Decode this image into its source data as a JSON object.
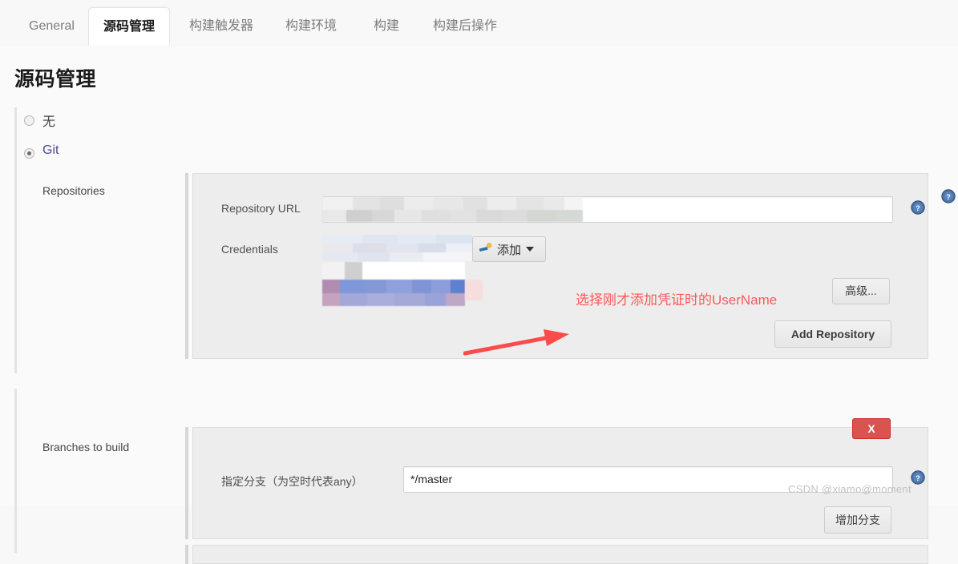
{
  "tabs": [
    {
      "label": "General",
      "active": false
    },
    {
      "label": "源码管理",
      "active": true
    },
    {
      "label": "构建触发器",
      "active": false
    },
    {
      "label": "构建环境",
      "active": false
    },
    {
      "label": "构建",
      "active": false
    },
    {
      "label": "构建后操作",
      "active": false
    }
  ],
  "page": {
    "title": "源码管理"
  },
  "scm_options": [
    {
      "label": "无",
      "selected": false
    },
    {
      "label": "Git",
      "selected": true
    }
  ],
  "repositories": {
    "section_label": "Repositories",
    "repository_url": {
      "label": "Repository URL",
      "value": "",
      "redacted": true
    },
    "credentials": {
      "label": "Credentials",
      "value": "",
      "redacted": true,
      "add_button": {
        "label": "添加",
        "icon": "key-icon",
        "caret": "chevron-down-icon"
      },
      "dropdown_open": true,
      "selected_option_redacted": true
    },
    "advanced_button": "高级...",
    "add_repository_button": "Add Repository",
    "help_icon": "help-icon"
  },
  "branches": {
    "section_label": "Branches to build",
    "branch_spec": {
      "label": "指定分支（为空时代表any）",
      "value": "*/master"
    },
    "delete_button": "X",
    "add_branch_button": "增加分支",
    "help_icon": "help-icon"
  },
  "annotation": {
    "text": "选择刚才添加凭证时的UserName",
    "color": "#fb5a5a",
    "arrow": "left-arrow-icon"
  },
  "watermark": "CSDN @xiamo@moment",
  "colors": {
    "accent_blue": "#36629d",
    "danger_red": "#d9534f",
    "annotation_red": "#fb5a5a",
    "panel_bg": "#ededed",
    "page_bg": "#fafafa"
  }
}
